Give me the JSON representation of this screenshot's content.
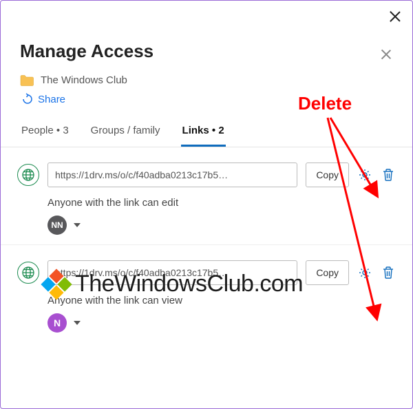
{
  "header": {
    "title": "Manage Access",
    "folder_name": "The Windows Club",
    "share_label": "Share"
  },
  "tabs": {
    "people": {
      "label": "People",
      "count": 3
    },
    "groups": {
      "label": "Groups / family"
    },
    "links": {
      "label": "Links",
      "count": 2
    }
  },
  "links": [
    {
      "url": "https://1drv.ms/o/c/f40adba0213c17b5…",
      "copy_label": "Copy",
      "permission_text": "Anyone with the link can edit",
      "avatars": [
        {
          "initials": "NN",
          "style": "gray"
        }
      ]
    },
    {
      "url": "https://1drv.ms/o/c/f40adba0213c17b5…",
      "copy_label": "Copy",
      "permission_text": "Anyone with the link can view",
      "avatars": [
        {
          "initials": "N",
          "style": "purple"
        }
      ]
    }
  ],
  "annotation": {
    "label": "Delete"
  },
  "watermark": {
    "text": "TheWindowsClub.com"
  }
}
